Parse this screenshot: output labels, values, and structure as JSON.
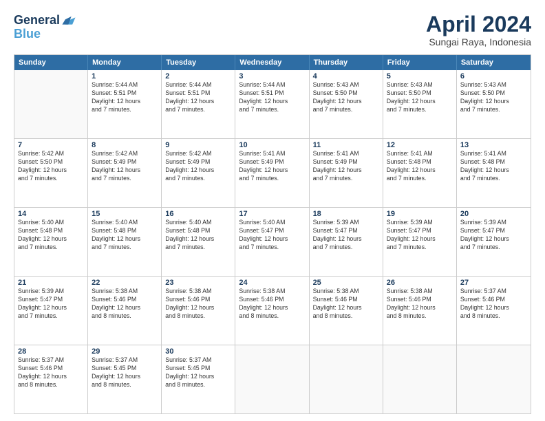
{
  "header": {
    "logo_general": "General",
    "logo_blue": "Blue",
    "month_title": "April 2024",
    "subtitle": "Sungai Raya, Indonesia"
  },
  "days_of_week": [
    "Sunday",
    "Monday",
    "Tuesday",
    "Wednesday",
    "Thursday",
    "Friday",
    "Saturday"
  ],
  "weeks": [
    [
      {
        "day": "",
        "info": ""
      },
      {
        "day": "1",
        "info": "Sunrise: 5:44 AM\nSunset: 5:51 PM\nDaylight: 12 hours\nand 7 minutes."
      },
      {
        "day": "2",
        "info": "Sunrise: 5:44 AM\nSunset: 5:51 PM\nDaylight: 12 hours\nand 7 minutes."
      },
      {
        "day": "3",
        "info": "Sunrise: 5:44 AM\nSunset: 5:51 PM\nDaylight: 12 hours\nand 7 minutes."
      },
      {
        "day": "4",
        "info": "Sunrise: 5:43 AM\nSunset: 5:50 PM\nDaylight: 12 hours\nand 7 minutes."
      },
      {
        "day": "5",
        "info": "Sunrise: 5:43 AM\nSunset: 5:50 PM\nDaylight: 12 hours\nand 7 minutes."
      },
      {
        "day": "6",
        "info": "Sunrise: 5:43 AM\nSunset: 5:50 PM\nDaylight: 12 hours\nand 7 minutes."
      }
    ],
    [
      {
        "day": "7",
        "info": "Sunrise: 5:42 AM\nSunset: 5:50 PM\nDaylight: 12 hours\nand 7 minutes."
      },
      {
        "day": "8",
        "info": "Sunrise: 5:42 AM\nSunset: 5:49 PM\nDaylight: 12 hours\nand 7 minutes."
      },
      {
        "day": "9",
        "info": "Sunrise: 5:42 AM\nSunset: 5:49 PM\nDaylight: 12 hours\nand 7 minutes."
      },
      {
        "day": "10",
        "info": "Sunrise: 5:41 AM\nSunset: 5:49 PM\nDaylight: 12 hours\nand 7 minutes."
      },
      {
        "day": "11",
        "info": "Sunrise: 5:41 AM\nSunset: 5:49 PM\nDaylight: 12 hours\nand 7 minutes."
      },
      {
        "day": "12",
        "info": "Sunrise: 5:41 AM\nSunset: 5:48 PM\nDaylight: 12 hours\nand 7 minutes."
      },
      {
        "day": "13",
        "info": "Sunrise: 5:41 AM\nSunset: 5:48 PM\nDaylight: 12 hours\nand 7 minutes."
      }
    ],
    [
      {
        "day": "14",
        "info": "Sunrise: 5:40 AM\nSunset: 5:48 PM\nDaylight: 12 hours\nand 7 minutes."
      },
      {
        "day": "15",
        "info": "Sunrise: 5:40 AM\nSunset: 5:48 PM\nDaylight: 12 hours\nand 7 minutes."
      },
      {
        "day": "16",
        "info": "Sunrise: 5:40 AM\nSunset: 5:48 PM\nDaylight: 12 hours\nand 7 minutes."
      },
      {
        "day": "17",
        "info": "Sunrise: 5:40 AM\nSunset: 5:47 PM\nDaylight: 12 hours\nand 7 minutes."
      },
      {
        "day": "18",
        "info": "Sunrise: 5:39 AM\nSunset: 5:47 PM\nDaylight: 12 hours\nand 7 minutes."
      },
      {
        "day": "19",
        "info": "Sunrise: 5:39 AM\nSunset: 5:47 PM\nDaylight: 12 hours\nand 7 minutes."
      },
      {
        "day": "20",
        "info": "Sunrise: 5:39 AM\nSunset: 5:47 PM\nDaylight: 12 hours\nand 7 minutes."
      }
    ],
    [
      {
        "day": "21",
        "info": "Sunrise: 5:39 AM\nSunset: 5:47 PM\nDaylight: 12 hours\nand 7 minutes."
      },
      {
        "day": "22",
        "info": "Sunrise: 5:38 AM\nSunset: 5:46 PM\nDaylight: 12 hours\nand 8 minutes."
      },
      {
        "day": "23",
        "info": "Sunrise: 5:38 AM\nSunset: 5:46 PM\nDaylight: 12 hours\nand 8 minutes."
      },
      {
        "day": "24",
        "info": "Sunrise: 5:38 AM\nSunset: 5:46 PM\nDaylight: 12 hours\nand 8 minutes."
      },
      {
        "day": "25",
        "info": "Sunrise: 5:38 AM\nSunset: 5:46 PM\nDaylight: 12 hours\nand 8 minutes."
      },
      {
        "day": "26",
        "info": "Sunrise: 5:38 AM\nSunset: 5:46 PM\nDaylight: 12 hours\nand 8 minutes."
      },
      {
        "day": "27",
        "info": "Sunrise: 5:37 AM\nSunset: 5:46 PM\nDaylight: 12 hours\nand 8 minutes."
      }
    ],
    [
      {
        "day": "28",
        "info": "Sunrise: 5:37 AM\nSunset: 5:46 PM\nDaylight: 12 hours\nand 8 minutes."
      },
      {
        "day": "29",
        "info": "Sunrise: 5:37 AM\nSunset: 5:45 PM\nDaylight: 12 hours\nand 8 minutes."
      },
      {
        "day": "30",
        "info": "Sunrise: 5:37 AM\nSunset: 5:45 PM\nDaylight: 12 hours\nand 8 minutes."
      },
      {
        "day": "",
        "info": ""
      },
      {
        "day": "",
        "info": ""
      },
      {
        "day": "",
        "info": ""
      },
      {
        "day": "",
        "info": ""
      }
    ]
  ]
}
